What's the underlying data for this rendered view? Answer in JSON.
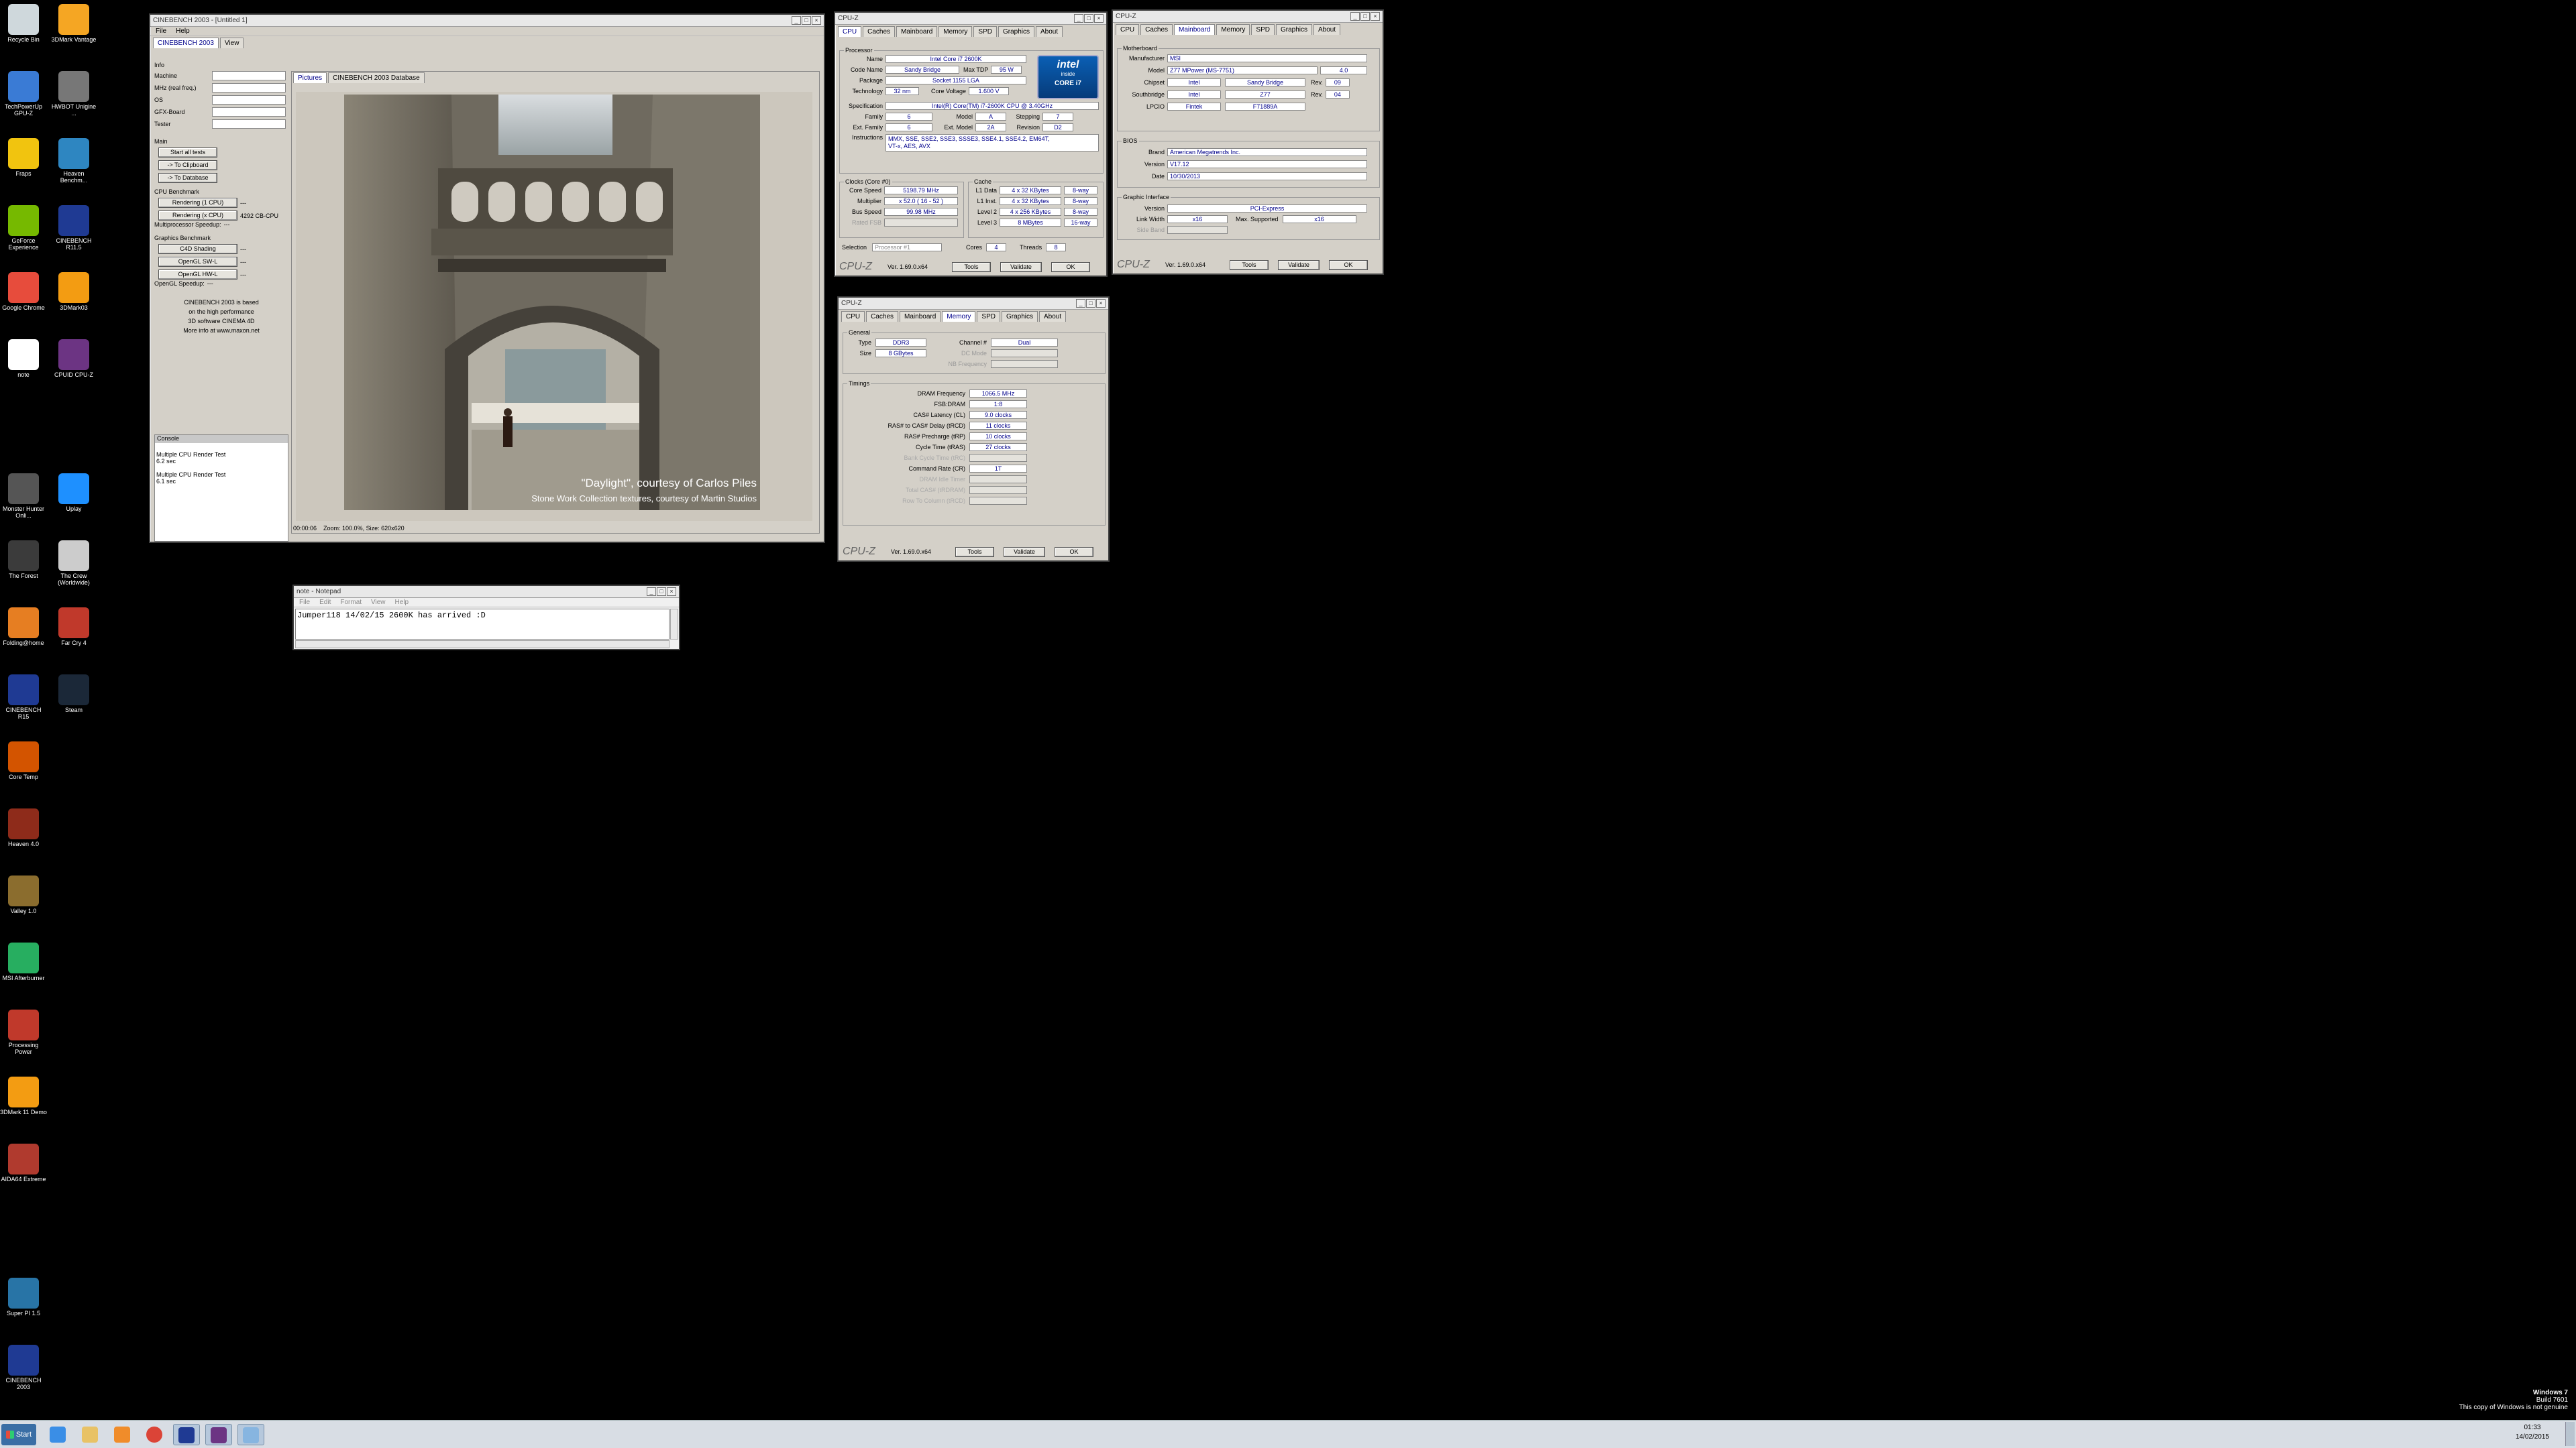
{
  "desktop_icons": [
    {
      "label": "Recycle Bin",
      "color": "#cfd8dc"
    },
    {
      "label": "3DMark Vantage",
      "color": "#f5a623"
    },
    {
      "label": "TechPowerUp GPU-Z",
      "color": "#3a7bd5"
    },
    {
      "label": "HWBOT Unigine ...",
      "color": "#777777"
    },
    {
      "label": "Fraps",
      "color": "#f1c40f"
    },
    {
      "label": "Heaven Benchm...",
      "color": "#2e86c1"
    },
    {
      "label": "GeForce Experience",
      "color": "#76b900"
    },
    {
      "label": "CINEBENCH R11.5",
      "color": "#1f3a93"
    },
    {
      "label": "Google Chrome",
      "color": "#e74c3c"
    },
    {
      "label": "3DMark03",
      "color": "#f39c12"
    },
    {
      "label": "note",
      "color": "#ffffff"
    },
    {
      "label": "CPUID CPU-Z",
      "color": "#6c3483"
    },
    {
      "label": "Monster Hunter Onli...",
      "color": "#555555"
    },
    {
      "label": "Uplay",
      "color": "#1e90ff"
    },
    {
      "label": "The Forest",
      "color": "#3b3b3b"
    },
    {
      "label": "The Crew (Worldwide)",
      "color": "#cccccc"
    },
    {
      "label": "Folding@home",
      "color": "#e67e22"
    },
    {
      "label": "Far Cry 4",
      "color": "#c0392b"
    },
    {
      "label": "CINEBENCH R15",
      "color": "#1f3a93"
    },
    {
      "label": "Steam",
      "color": "#1b2838"
    },
    {
      "label": "Core Temp",
      "color": "#d35400"
    },
    {
      "label": "Heaven 4.0",
      "color": "#8e2b1a"
    },
    {
      "label": "Valley 1.0",
      "color": "#8b6d2e"
    },
    {
      "label": "MSI Afterburner",
      "color": "#27ae60"
    },
    {
      "label": "Processing Power",
      "color": "#c0392b"
    },
    {
      "label": "3DMark 11 Demo",
      "color": "#f39c12"
    },
    {
      "label": "AIDA64 Extreme",
      "color": "#b03a2e"
    },
    {
      "label": "Super PI 1.5",
      "color": "#2874a6"
    },
    {
      "label": "CINEBENCH 2003",
      "color": "#1f3a93"
    }
  ],
  "cinebench": {
    "title": "CINEBENCH 2003 - [Untitled 1]",
    "menu": [
      "File",
      "Help"
    ],
    "tabs": [
      "CINEBENCH 2003",
      "View"
    ],
    "info_header": "Info",
    "info_fields": [
      "Machine",
      "MHz (real freq.)",
      "OS",
      "GFX-Board",
      "Tester"
    ],
    "main_header": "Main",
    "main_buttons": [
      "Start all tests",
      "-> To Clipboard",
      "-> To Database"
    ],
    "cpu_header": "CPU Benchmark",
    "cpu_rows": [
      {
        "label": "Rendering (1 CPU)",
        "value": "---"
      },
      {
        "label": "Rendering (x CPU)",
        "value": "4292 CB-CPU"
      }
    ],
    "mp_speedup_label": "Multiprocessor Speedup:",
    "mp_speedup_value": "---",
    "gfx_header": "Graphics Benchmark",
    "gfx_rows": [
      {
        "label": "C4D Shading",
        "value": "---"
      },
      {
        "label": "OpenGL SW-L",
        "value": "---"
      },
      {
        "label": "OpenGL HW-L",
        "value": "---"
      }
    ],
    "opengl_speedup_label": "OpenGL Speedup:",
    "opengl_speedup_value": "---",
    "about_lines": [
      "CINEBENCH 2003 is based",
      "on the high performance",
      "3D software CINEMA 4D",
      "More info at www.maxon.net"
    ],
    "console_title": "Console",
    "console_lines": [
      "Multiple CPU Render Test",
      "6.2 sec",
      "",
      "Multiple CPU Render Test",
      "6.1 sec"
    ],
    "picture_tabs": [
      "Pictures",
      "CINEBENCH 2003 Database"
    ],
    "caption_line1": "\"Daylight\", courtesy of Carlos Piles",
    "caption_line2": "Stone Work Collection textures, courtesy of Martin Studios",
    "status": "00:00:06    Zoom: 100.0%, Size: 620x620"
  },
  "cpuz_cpu": {
    "title": "CPU-Z",
    "tabs": [
      "CPU",
      "Caches",
      "Mainboard",
      "Memory",
      "SPD",
      "Graphics",
      "About"
    ],
    "processor_header": "Processor",
    "name": "Intel Core i7 2600K",
    "code_name": "Sandy Bridge",
    "max_tdp_label": "Max TDP",
    "max_tdp": "95 W",
    "package": "Socket 1155 LGA",
    "technology": "32 nm",
    "core_voltage_label": "Core Voltage",
    "core_voltage": "1.600 V",
    "specification": "Intel(R) Core(TM) i7-2600K CPU @ 3.40GHz",
    "family": "6",
    "model": "A",
    "stepping": "7",
    "ext_family": "6",
    "ext_model": "2A",
    "revision": "D2",
    "instructions_1": "MMX, SSE, SSE2, SSE3, SSSE3, SSE4.1, SSE4.2, EM64T,",
    "instructions_2": "VT-x, AES, AVX",
    "labels": {
      "name": "Name",
      "code_name": "Code Name",
      "package": "Package",
      "technology": "Technology",
      "specification": "Specification",
      "family": "Family",
      "model": "Model",
      "stepping": "Stepping",
      "ext_family": "Ext. Family",
      "ext_model": "Ext. Model",
      "revision": "Revision",
      "instructions": "Instructions"
    },
    "clocks_header": "Clocks (Core #0)",
    "core_speed": "5198.79 MHz",
    "multiplier": "x 52.0 ( 16 - 52 )",
    "bus_speed": "99.98 MHz",
    "rated_fsb": "",
    "clock_labels": [
      "Core Speed",
      "Multiplier",
      "Bus Speed",
      "Rated FSB"
    ],
    "cache_header": "Cache",
    "cache_rows": [
      {
        "label": "L1 Data",
        "size": "4 x 32 KBytes",
        "way": "8-way"
      },
      {
        "label": "L1 Inst.",
        "size": "4 x 32 KBytes",
        "way": "8-way"
      },
      {
        "label": "Level 2",
        "size": "4 x 256 KBytes",
        "way": "8-way"
      },
      {
        "label": "Level 3",
        "size": "8 MBytes",
        "way": "16-way"
      }
    ],
    "selection_label": "Selection",
    "selection": "Processor #1",
    "cores_label": "Cores",
    "cores": "4",
    "threads_label": "Threads",
    "threads": "8",
    "brand": "CPU-Z",
    "version": "Ver. 1.69.0.x64",
    "tools": "Tools",
    "validate": "Validate",
    "ok": "OK",
    "logo_line1": "intel",
    "logo_line2": "inside",
    "logo_line3": "CORE i7"
  },
  "cpuz_mb": {
    "title": "CPU-Z",
    "tabs": [
      "CPU",
      "Caches",
      "Mainboard",
      "Memory",
      "SPD",
      "Graphics",
      "About"
    ],
    "mb_header": "Motherboard",
    "manufacturer": "MSI",
    "model": "Z77 MPower (MS-7751)",
    "model_rev": "4.0",
    "chipset": "Intel",
    "chipset_name": "Sandy Bridge",
    "chipset_rev": "09",
    "southbridge": "Intel",
    "southbridge_name": "Z77",
    "southbridge_rev": "04",
    "lpcio": "Fintek",
    "lpcio_name": "F71889A",
    "mb_labels": [
      "Manufacturer",
      "Model",
      "Chipset",
      "Southbridge",
      "LPCIO"
    ],
    "rev_label": "Rev.",
    "bios_header": "BIOS",
    "bios_brand": "American Megatrends Inc.",
    "bios_version": "V17.12",
    "bios_date": "10/30/2013",
    "bios_labels": [
      "Brand",
      "Version",
      "Date"
    ],
    "gi_header": "Graphic Interface",
    "gi_version": "PCI-Express",
    "gi_link_width": "x16",
    "gi_max_supported": "x16",
    "gi_labels": [
      "Version",
      "Link Width",
      "Max. Supported",
      "Side Band"
    ],
    "brand": "CPU-Z",
    "version": "Ver. 1.69.0.x64",
    "tools": "Tools",
    "validate": "Validate",
    "ok": "OK"
  },
  "cpuz_mem": {
    "title": "CPU-Z",
    "tabs": [
      "CPU",
      "Caches",
      "Mainboard",
      "Memory",
      "SPD",
      "Graphics",
      "About"
    ],
    "general_header": "General",
    "type_label": "Type",
    "type": "DDR3",
    "size_label": "Size",
    "size": "8 GBytes",
    "channel_label": "Channel #",
    "channel": "Dual",
    "dc_mode_label": "DC Mode",
    "nb_freq_label": "NB Frequency",
    "timings_header": "Timings",
    "timings": [
      {
        "label": "DRAM Frequency",
        "value": "1066.5 MHz",
        "active": true
      },
      {
        "label": "FSB:DRAM",
        "value": "1:8",
        "active": true
      },
      {
        "label": "CAS# Latency (CL)",
        "value": "9.0 clocks",
        "active": true
      },
      {
        "label": "RAS# to CAS# Delay (tRCD)",
        "value": "11 clocks",
        "active": true
      },
      {
        "label": "RAS# Precharge (tRP)",
        "value": "10 clocks",
        "active": true
      },
      {
        "label": "Cycle Time (tRAS)",
        "value": "27 clocks",
        "active": true
      },
      {
        "label": "Bank Cycle Time (tRC)",
        "value": "",
        "active": false
      },
      {
        "label": "Command Rate (CR)",
        "value": "1T",
        "active": true
      },
      {
        "label": "DRAM Idle Timer",
        "value": "",
        "active": false
      },
      {
        "label": "Total CAS# (tRDRAM)",
        "value": "",
        "active": false
      },
      {
        "label": "Row To Column (tRCD)",
        "value": "",
        "active": false
      }
    ],
    "brand": "CPU-Z",
    "version": "Ver. 1.69.0.x64",
    "tools": "Tools",
    "validate": "Validate",
    "ok": "OK"
  },
  "notepad": {
    "title": "note - Notepad",
    "menu": [
      "File",
      "Edit",
      "Format",
      "View",
      "Help"
    ],
    "content": "Jumper118 14/02/15 2600K has arrived :D"
  },
  "taskbar": {
    "start": "Start",
    "apps": [
      {
        "name": "ie-icon",
        "color": "#3a8ee6"
      },
      {
        "name": "explorer-icon",
        "color": "#e8c266"
      },
      {
        "name": "media-player-icon",
        "color": "#f08c2a"
      },
      {
        "name": "chrome-icon",
        "color": "#db4437"
      },
      {
        "name": "cinebench-icon",
        "color": "#1f3a93"
      },
      {
        "name": "cpuz-icon",
        "color": "#6c3483"
      },
      {
        "name": "notepad-icon",
        "color": "#87b5e0"
      }
    ],
    "time": "01:33",
    "date": "14/02/2015"
  },
  "watermark": {
    "line1": "Windows 7",
    "line2": "Build 7601",
    "line3": "This copy of Windows is not genuine"
  }
}
